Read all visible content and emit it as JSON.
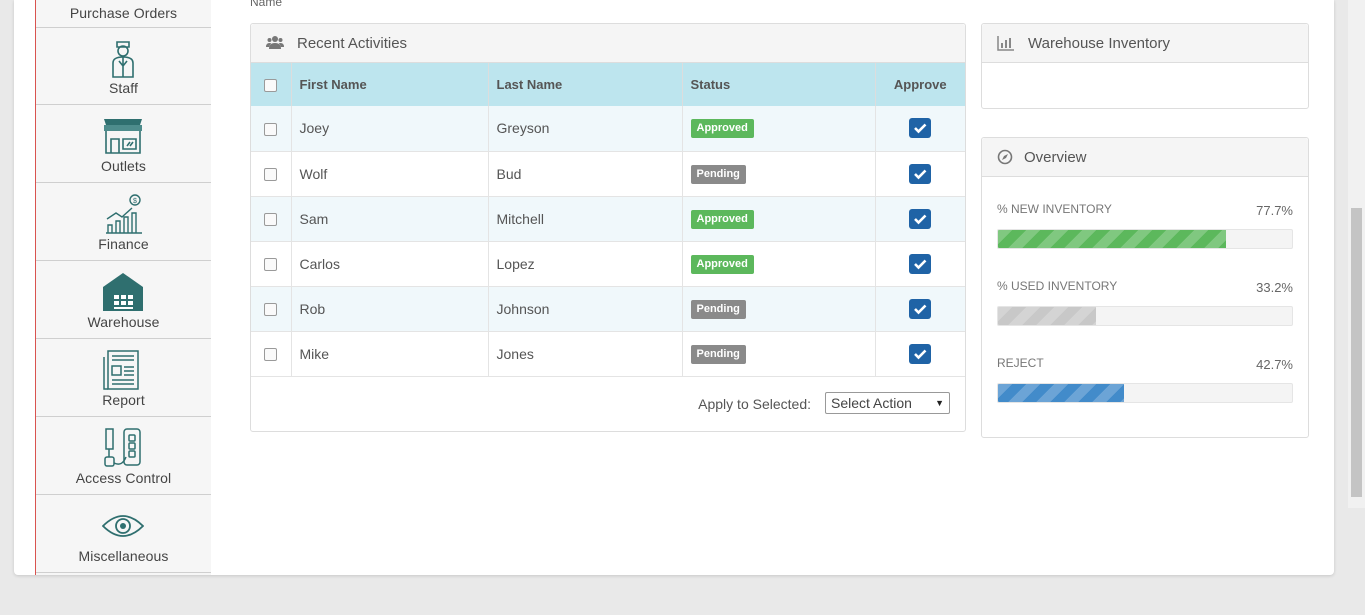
{
  "top_label": "Name",
  "sidebar": {
    "items": [
      {
        "label": "Purchase Orders",
        "icon": "purchase-orders-icon"
      },
      {
        "label": "Staff",
        "icon": "staff-icon"
      },
      {
        "label": "Outlets",
        "icon": "outlets-icon"
      },
      {
        "label": "Finance",
        "icon": "finance-icon"
      },
      {
        "label": "Warehouse",
        "icon": "warehouse-icon"
      },
      {
        "label": "Report",
        "icon": "report-icon"
      },
      {
        "label": "Access Control",
        "icon": "access-control-icon"
      },
      {
        "label": "Miscellaneous",
        "icon": "miscellaneous-icon"
      }
    ]
  },
  "recent": {
    "title": "Recent Activities",
    "icon": "users-icon",
    "columns": [
      "First Name",
      "Last Name",
      "Status",
      "Approve"
    ],
    "rows": [
      {
        "first": "Joey",
        "last": "Greyson",
        "status": "Approved"
      },
      {
        "first": "Wolf",
        "last": "Bud",
        "status": "Pending"
      },
      {
        "first": "Sam",
        "last": "Mitchell",
        "status": "Approved"
      },
      {
        "first": "Carlos",
        "last": "Lopez",
        "status": "Approved"
      },
      {
        "first": "Rob",
        "last": "Johnson",
        "status": "Pending"
      },
      {
        "first": "Mike",
        "last": "Jones",
        "status": "Pending"
      }
    ],
    "apply_label": "Apply to Selected:",
    "select_value": "Select Action"
  },
  "warehouse": {
    "title": "Warehouse Inventory",
    "icon": "bar-chart-icon"
  },
  "overview": {
    "title": "Overview",
    "icon": "compass-icon",
    "items": [
      {
        "label": "% NEW INVENTORY",
        "value": "77.7%",
        "percent": 77.7,
        "color": "#5cb85c"
      },
      {
        "label": "% USED INVENTORY",
        "value": "33.2%",
        "percent": 33.2,
        "color": "#c8c8c8"
      },
      {
        "label": "REJECT",
        "value": "42.7%",
        "percent": 42.7,
        "color": "#428bca"
      }
    ]
  },
  "colors": {
    "approved": "#5cb85c",
    "pending": "#8a8a8a",
    "header_row": "#bde5ee",
    "check": "#1f63a6",
    "sidebar_accent": "#d9534f",
    "icon_teal": "#2f6f6f"
  }
}
